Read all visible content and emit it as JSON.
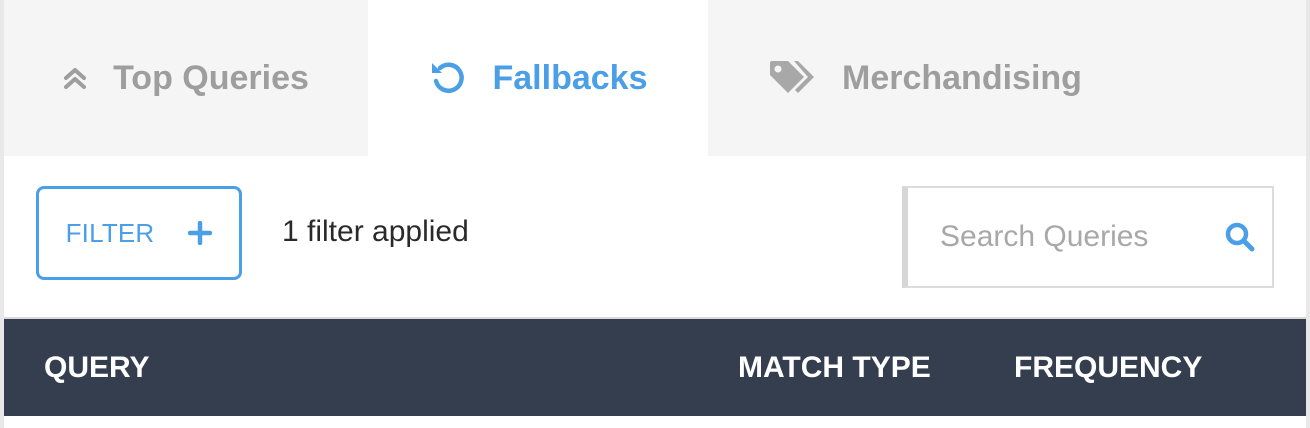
{
  "tabs": [
    {
      "label": "Top Queries",
      "icon": "double-chevron-up-icon",
      "active": false
    },
    {
      "label": "Fallbacks",
      "icon": "undo-icon",
      "active": true
    },
    {
      "label": "Merchandising",
      "icon": "tags-icon",
      "active": false
    }
  ],
  "toolbar": {
    "filter_label": "FILTER",
    "filter_status": "1 filter applied",
    "search_placeholder": "Search Queries",
    "search_value": ""
  },
  "table": {
    "columns": [
      "QUERY",
      "MATCH TYPE",
      "FREQUENCY"
    ]
  },
  "colors": {
    "accent": "#4a9fe6",
    "header_bg": "#343e4f",
    "tab_bg": "#f5f5f5",
    "inactive_text": "#9e9e9e"
  }
}
